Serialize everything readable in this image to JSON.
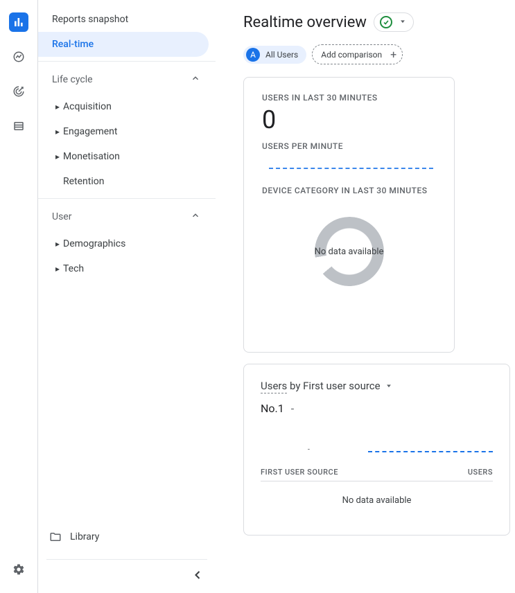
{
  "rail": {
    "icons": [
      "reports",
      "realtime",
      "advertising",
      "explore"
    ],
    "settings": "settings"
  },
  "nav": {
    "items": [
      {
        "label": "Reports snapshot",
        "active": false
      },
      {
        "label": "Real-time",
        "active": true
      }
    ],
    "groups": [
      {
        "label": "Life cycle",
        "items": [
          {
            "label": "Acquisition",
            "expandable": true
          },
          {
            "label": "Engagement",
            "expandable": true
          },
          {
            "label": "Monetisation",
            "expandable": true
          },
          {
            "label": "Retention",
            "expandable": false
          }
        ]
      },
      {
        "label": "User",
        "items": [
          {
            "label": "Demographics",
            "expandable": true
          },
          {
            "label": "Tech",
            "expandable": true
          }
        ]
      }
    ],
    "library_label": "Library"
  },
  "header": {
    "title": "Realtime overview"
  },
  "comparison": {
    "all_users_avatar": "A",
    "all_users_label": "All Users",
    "add_label": "Add comparison"
  },
  "card_users": {
    "label_30min": "USERS IN LAST 30 MINUTES",
    "value": "0",
    "label_per_min": "USERS PER MINUTE",
    "label_device": "DEVICE CATEGORY IN LAST 30 MINUTES",
    "no_data": "No data available"
  },
  "card_source": {
    "heading_prefix": "Users",
    "heading_rest": " by First user source",
    "rank_label": "No.1",
    "rank_value": "-",
    "mini_dash": "-",
    "col_left": "FIRST USER SOURCE",
    "col_right": "USERS",
    "no_data": "No data available"
  }
}
